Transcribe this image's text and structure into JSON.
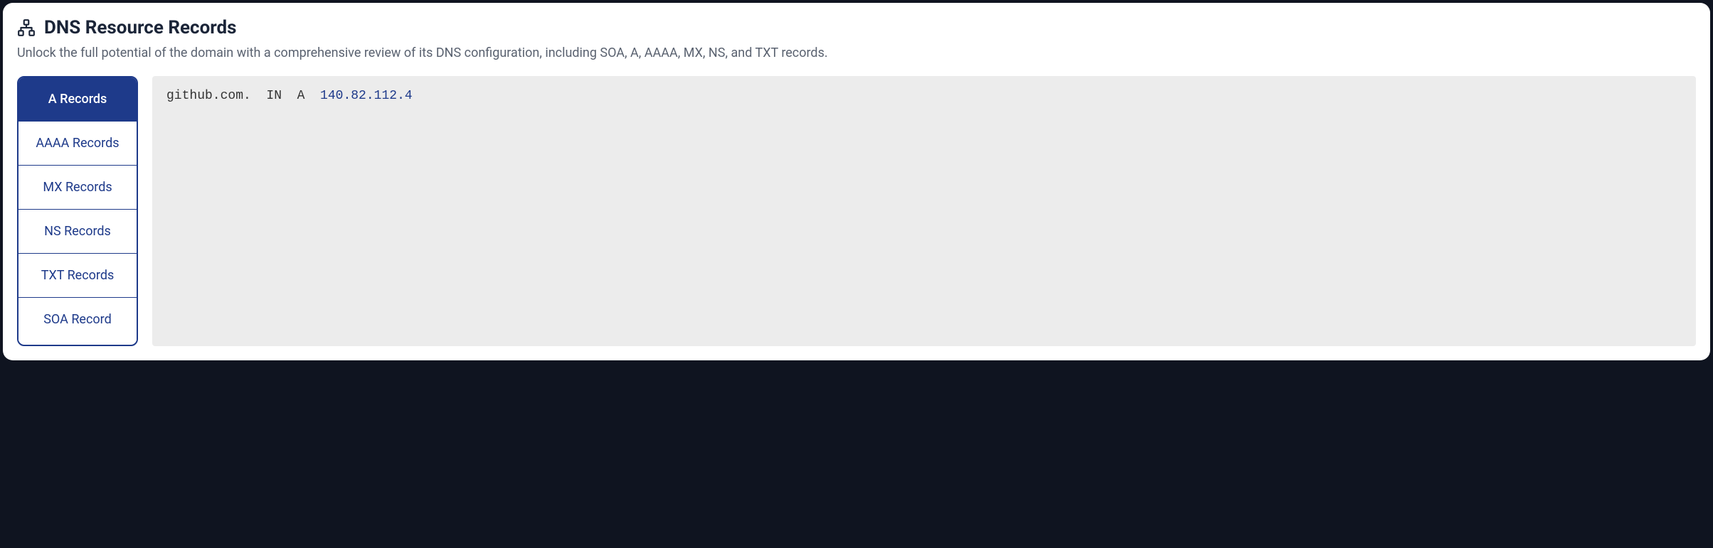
{
  "header": {
    "title": "DNS Resource Records",
    "subtitle": "Unlock the full potential of the domain with a comprehensive review of its DNS configuration, including SOA, A, AAAA, MX, NS, and TXT records."
  },
  "tabs": [
    {
      "label": "A Records",
      "active": true
    },
    {
      "label": "AAAA Records",
      "active": false
    },
    {
      "label": "MX Records",
      "active": false
    },
    {
      "label": "NS Records",
      "active": false
    },
    {
      "label": "TXT Records",
      "active": false
    },
    {
      "label": "SOA Record",
      "active": false
    }
  ],
  "record": {
    "prefix": "github.com.  IN  A  ",
    "value": "140.82.112.4"
  }
}
